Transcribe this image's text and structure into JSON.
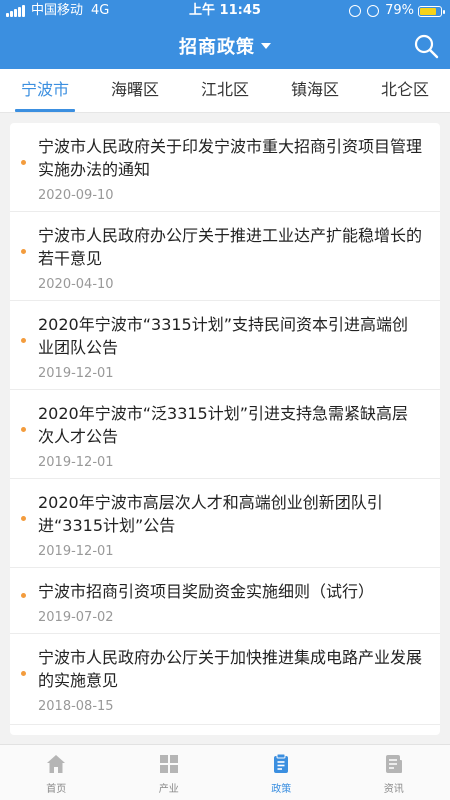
{
  "status_bar": {
    "carrier": "中国移动",
    "network": "4G",
    "time": "上午 11:45",
    "battery_percent": "79%",
    "battery_level": 0.79
  },
  "header": {
    "title": "招商政策",
    "dropdown_icon": "caret-down-icon",
    "search_icon": "search-icon",
    "background_color": "#3b8fe0"
  },
  "tabs": [
    {
      "label": "宁波市",
      "active": true
    },
    {
      "label": "海曙区",
      "active": false
    },
    {
      "label": "江北区",
      "active": false
    },
    {
      "label": "镇海区",
      "active": false
    },
    {
      "label": "北仑区",
      "active": false
    }
  ],
  "articles": [
    {
      "title": "宁波市人民政府关于印发宁波市重大招商引资项目管理实施办法的通知",
      "date": "2020-09-10"
    },
    {
      "title": "宁波市人民政府办公厅关于推进工业达产扩能稳增长的若干意见",
      "date": "2020-04-10"
    },
    {
      "title": "2020年宁波市“3315计划”支持民间资本引进高端创业团队公告",
      "date": "2019-12-01"
    },
    {
      "title": "2020年宁波市“泛3315计划”引进支持急需紧缺高层次人才公告",
      "date": "2019-12-01"
    },
    {
      "title": "2020年宁波市高层次人才和高端创业创新团队引进“3315计划”公告",
      "date": "2019-12-01"
    },
    {
      "title": "宁波市招商引资项目奖励资金实施细则（试行）",
      "date": "2019-07-02"
    },
    {
      "title": "宁波市人民政府办公厅关于加快推进集成电路产业发展的实施意见",
      "date": "2018-08-15"
    }
  ],
  "bottom_nav": [
    {
      "label": "首页",
      "icon": "home-icon",
      "active": false
    },
    {
      "label": "产业",
      "icon": "grid-icon",
      "active": false
    },
    {
      "label": "政策",
      "icon": "document-icon",
      "active": true
    },
    {
      "label": "资讯",
      "icon": "news-icon",
      "active": false
    }
  ],
  "colors": {
    "accent": "#3b8fe0",
    "bullet": "#f39c3d",
    "inactive_icon": "#b5b5b5"
  }
}
